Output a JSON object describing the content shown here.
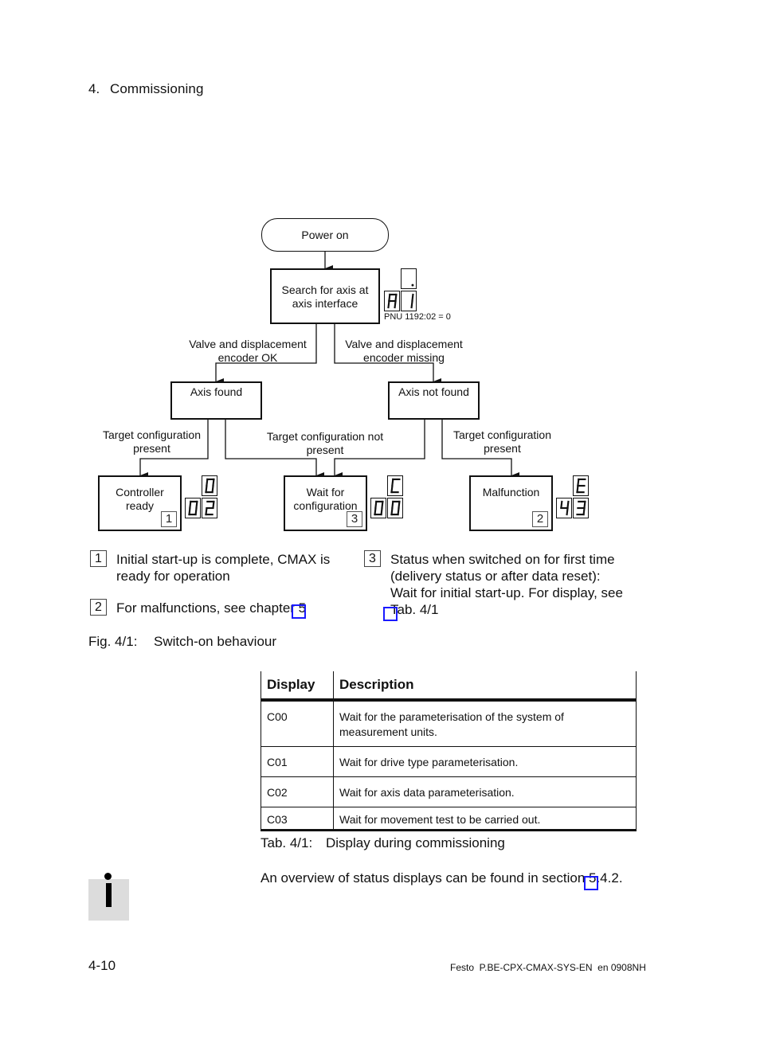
{
  "header": {
    "chapter_number": "4.",
    "chapter_title": "Commissioning"
  },
  "flowchart": {
    "nodes": {
      "power_on": "Power on",
      "search_axis": [
        "Search for axis at",
        "axis interface"
      ],
      "axis_found": "Axis found",
      "axis_not_found": "Axis not found",
      "controller_ready": [
        "Controller",
        "ready"
      ],
      "wait_config": [
        "Wait for",
        "configuration"
      ],
      "malfunction": "Malfunction"
    },
    "edge_labels": {
      "valve_ok": [
        "Valve and displacement",
        "encoder OK"
      ],
      "valve_missing": [
        "Valve and displacement",
        "encoder missing"
      ],
      "target_present_left": [
        "Target configuration",
        "present"
      ],
      "target_not_present": [
        "Target configuration not",
        "present"
      ],
      "target_present_right": [
        "Target configuration",
        "present"
      ]
    },
    "pnu_note": "PNU 1192:02 = 0",
    "ref_markers": {
      "controller_ready": "1",
      "wait_config": "3",
      "malfunction": "2"
    },
    "displays": {
      "search_axis": {
        "top": ".",
        "bottom_left": "A",
        "bottom_right": "1"
      },
      "controller_ready": {
        "top": "0",
        "bottom_left": "0",
        "bottom_right": "2"
      },
      "wait_config": {
        "top": "C",
        "bottom_left": "0",
        "bottom_right": "0"
      },
      "malfunction": {
        "top": "E",
        "bottom_left": "4",
        "bottom_right": "3"
      }
    }
  },
  "notes": [
    {
      "num": "1",
      "lines": [
        "Initial start-up is complete, CMAX is",
        "ready for operation"
      ]
    },
    {
      "num": "2",
      "lines": [
        "For malfunctions, see chapter 5"
      ]
    },
    {
      "num": "3",
      "lines": [
        "Status when switched on for first time",
        "(delivery status or after data reset):",
        "Wait for initial start-up. For display, see",
        "Tab. 4/1"
      ]
    }
  ],
  "figure_caption": {
    "number": "Fig. 4/1:",
    "title": "Switch-on behaviour"
  },
  "table": {
    "headers": [
      "Display",
      "Description"
    ],
    "rows": [
      [
        "C00",
        "Wait for the parameterisation of the system of measurement units."
      ],
      [
        "C01",
        "Wait for drive type parameterisation."
      ],
      [
        "C02",
        "Wait for axis data parameterisation."
      ],
      [
        "C03",
        "Wait for movement test to be carried out."
      ]
    ]
  },
  "table_caption": {
    "number": "Tab. 4/1:",
    "title": "Display during commissioning"
  },
  "info_note": "An overview of status displays can be found in section 5.4.2.",
  "footer": {
    "page": "4-10",
    "doc": "Festo  P.BE-CPX-CMAX-SYS-EN  en 0908NH"
  },
  "colors": {
    "link_marker": "#1a1aff",
    "info_icon_bg": "#dcdcdc"
  }
}
